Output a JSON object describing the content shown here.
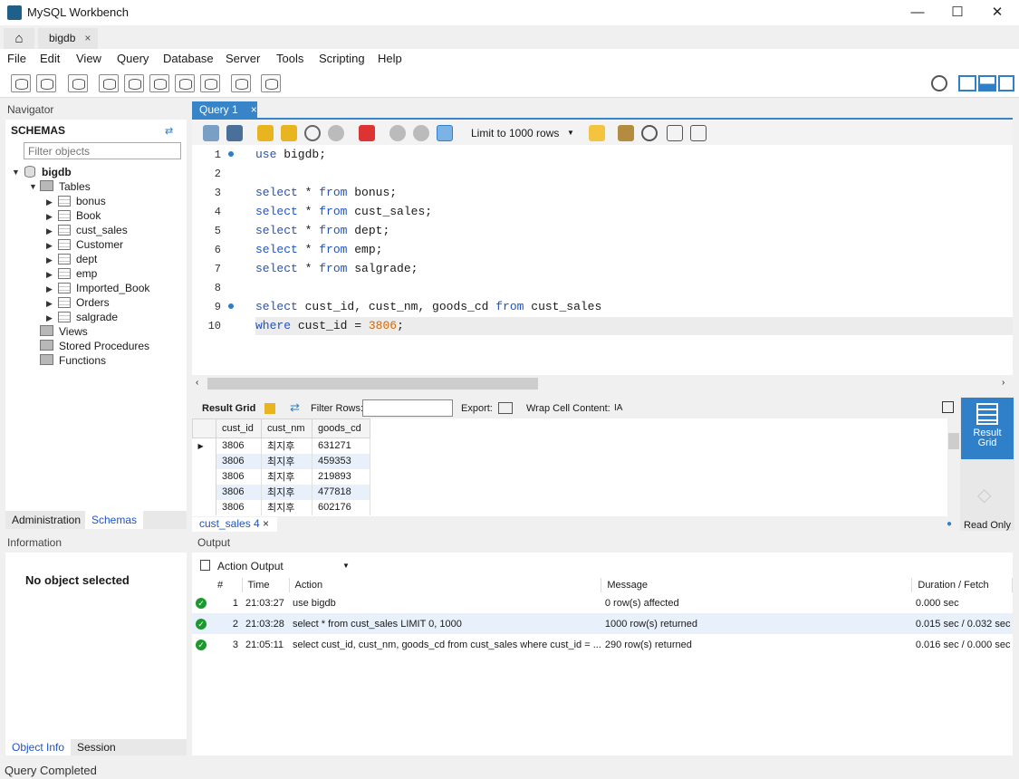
{
  "window": {
    "title": "MySQL Workbench",
    "minimize": "—",
    "maximize": "☐",
    "close": "✕"
  },
  "tabs": {
    "home_icon": "home-icon",
    "connection_tab": "bigdb",
    "close": "×"
  },
  "menu": [
    "File",
    "Edit",
    "View",
    "Query",
    "Database",
    "Server",
    "Tools",
    "Scripting",
    "Help"
  ],
  "navigator": {
    "header": "Navigator",
    "schemas_label": "SCHEMAS",
    "filter_placeholder": "Filter objects",
    "schema": "bigdb",
    "tables_label": "Tables",
    "tables": [
      "bonus",
      "Book",
      "cust_sales",
      "Customer",
      "dept",
      "emp",
      "Imported_Book",
      "Orders",
      "salgrade"
    ],
    "views": "Views",
    "procedures": "Stored Procedures",
    "functions": "Functions",
    "tab_admin": "Administration",
    "tab_schemas": "Schemas"
  },
  "information": {
    "header": "Information",
    "empty": "No object selected",
    "tab_objinfo": "Object Info",
    "tab_session": "Session"
  },
  "query_tab": {
    "label": "Query 1",
    "close": "×"
  },
  "sql_toolbar": {
    "limit": "Limit to 1000 rows"
  },
  "editor": {
    "line_numbers": [
      "1",
      "2",
      "3",
      "4",
      "5",
      "6",
      "7",
      "8",
      "9",
      "10"
    ]
  },
  "result": {
    "grid_label": "Result Grid",
    "filter_label": "Filter Rows:",
    "export_label": "Export:",
    "wrap_label": "Wrap Cell Content:",
    "columns": [
      "cust_id",
      "cust_nm",
      "goods_cd"
    ],
    "rows": [
      [
        "3806",
        "최지후",
        "631271"
      ],
      [
        "3806",
        "최지후",
        "459353"
      ],
      [
        "3806",
        "최지후",
        "219893"
      ],
      [
        "3806",
        "최지후",
        "477818"
      ],
      [
        "3806",
        "최지후",
        "602176"
      ]
    ],
    "result_tab": "cust_sales 4",
    "side_result_grid": "Result Grid",
    "side_readonly": "Read Only"
  },
  "output": {
    "header": "Output",
    "selector": "Action Output",
    "columns": [
      "#",
      "Time",
      "Action",
      "Message",
      "Duration / Fetch"
    ],
    "rows": [
      [
        "1",
        "21:03:27",
        "use bigdb",
        "0 row(s) affected",
        "0.000 sec"
      ],
      [
        "2",
        "21:03:28",
        "select * from cust_sales LIMIT 0, 1000",
        "1000 row(s) returned",
        "0.015 sec / 0.032 sec"
      ],
      [
        "3",
        "21:05:11",
        "select cust_id, cust_nm, goods_cd from cust_sales where cust_id = ...",
        "290 row(s) returned",
        "0.016 sec / 0.000 sec"
      ]
    ]
  },
  "status": "Query Completed"
}
